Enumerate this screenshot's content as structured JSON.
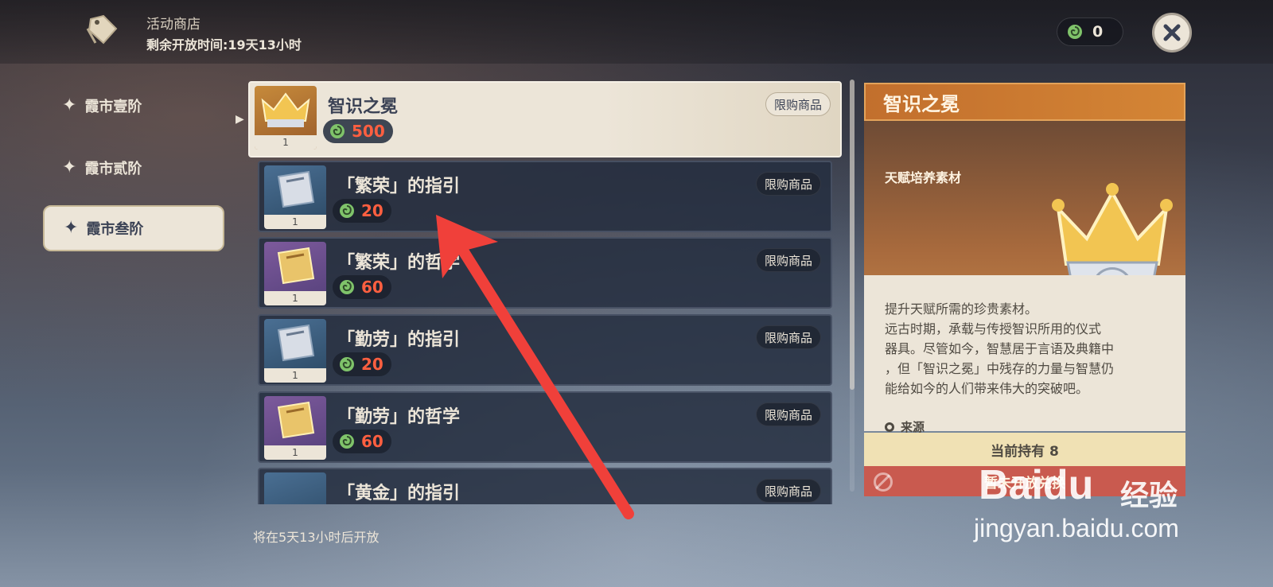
{
  "header": {
    "shop_title": "活动商店",
    "remaining_time": "剩余开放时间:19天13小时",
    "currency_count": "0",
    "icons": {
      "shop": "price-tag-icon",
      "currency": "leaf-token-icon",
      "close": "close-icon"
    }
  },
  "tabs": [
    {
      "label": "霞市壹阶",
      "active": false
    },
    {
      "label": "霞市贰阶",
      "active": false
    },
    {
      "label": "霞市叁阶",
      "active": true
    }
  ],
  "items": [
    {
      "name": "智识之冕",
      "price": "500",
      "qty": "1",
      "tag": "限购商品",
      "selected": true,
      "thumb": "gold"
    },
    {
      "name": "「繁荣」的指引",
      "price": "20",
      "qty": "1",
      "tag": "限购商品",
      "selected": false,
      "thumb": "blue"
    },
    {
      "name": "「繁荣」的哲学",
      "price": "60",
      "qty": "1",
      "tag": "限购商品",
      "selected": false,
      "thumb": "purple"
    },
    {
      "name": "「勤劳」的指引",
      "price": "20",
      "qty": "1",
      "tag": "限购商品",
      "selected": false,
      "thumb": "blue"
    },
    {
      "name": "「勤劳」的哲学",
      "price": "60",
      "qty": "1",
      "tag": "限购商品",
      "selected": false,
      "thumb": "purple"
    },
    {
      "name": "「黄金」的指引",
      "price": "",
      "qty": "",
      "tag": "限购商品",
      "selected": false,
      "thumb": "blue"
    }
  ],
  "open_note": "将在5天13小时后开放",
  "detail": {
    "title": "智识之冕",
    "type": "天赋培养素材",
    "stars": "★★★★★",
    "description": [
      "提升天赋所需的珍贵素材。",
      "远古时期，承载与传授智识所用的仪式",
      "器具。尽管如今，智慧居于言语及典籍中",
      "，但「智识之冕」中残存的力量与智慧仍",
      "能给如今的人们带来伟大的突破吧。"
    ],
    "source_label": "来源",
    "owned": "当前持有 8",
    "exchange": "暂未开放兑换"
  },
  "watermark": {
    "logo": "Baidu",
    "cn": "经验",
    "url": "jingyan.baidu.com"
  },
  "colors": {
    "accent_orange": "#c26f2d",
    "price_red": "#ff5f40",
    "star_gold": "#ffcc32",
    "annotation_red": "#f0403a"
  }
}
